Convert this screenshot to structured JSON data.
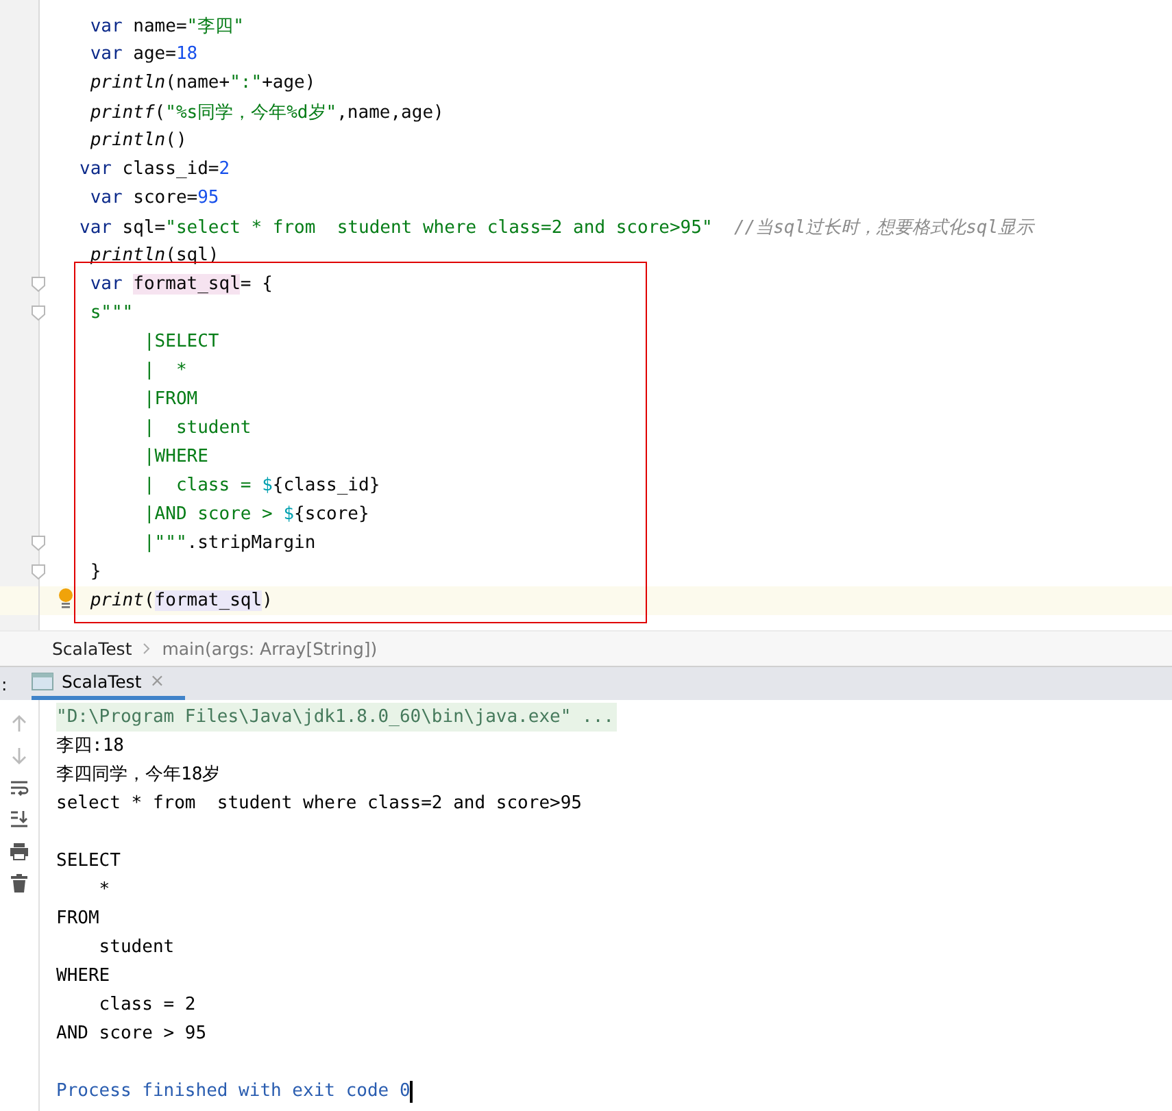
{
  "editor": {
    "lines": [
      {
        "fold": false,
        "current": false,
        "tokens": [
          {
            "kind": "keyword",
            "text": " var"
          },
          {
            "kind": "plain",
            "text": " name="
          },
          {
            "kind": "string",
            "text": "\"李四\""
          }
        ]
      },
      {
        "fold": false,
        "current": false,
        "tokens": [
          {
            "kind": "keyword",
            "text": " var"
          },
          {
            "kind": "plain",
            "text": " age="
          },
          {
            "kind": "number",
            "text": "18"
          }
        ]
      },
      {
        "fold": false,
        "current": false,
        "tokens": [
          {
            "kind": "call",
            "text": " println"
          },
          {
            "kind": "plain",
            "text": "(name+"
          },
          {
            "kind": "string",
            "text": "\":\""
          },
          {
            "kind": "plain",
            "text": "+age)"
          }
        ]
      },
      {
        "fold": false,
        "current": false,
        "tokens": [
          {
            "kind": "call",
            "text": " printf"
          },
          {
            "kind": "plain",
            "text": "("
          },
          {
            "kind": "string",
            "text": "\"%s同学，今年%d岁\""
          },
          {
            "kind": "plain",
            "text": ",name,age)"
          }
        ]
      },
      {
        "fold": false,
        "current": false,
        "tokens": [
          {
            "kind": "call",
            "text": " println"
          },
          {
            "kind": "plain",
            "text": "()"
          }
        ]
      },
      {
        "fold": false,
        "current": false,
        "tokens": [
          {
            "kind": "keyword",
            "text": "var"
          },
          {
            "kind": "plain",
            "text": " class_id="
          },
          {
            "kind": "number",
            "text": "2"
          }
        ]
      },
      {
        "fold": false,
        "current": false,
        "tokens": [
          {
            "kind": "keyword",
            "text": " var"
          },
          {
            "kind": "plain",
            "text": " score="
          },
          {
            "kind": "number",
            "text": "95"
          }
        ]
      },
      {
        "fold": false,
        "current": false,
        "tokens": [
          {
            "kind": "keyword",
            "text": "var"
          },
          {
            "kind": "plain",
            "text": " sql="
          },
          {
            "kind": "string",
            "text": "\"select * from  student where class=2 and score>95\""
          },
          {
            "kind": "comment",
            "text": "  //当sql过长时，想要格式化sql显示"
          }
        ]
      },
      {
        "fold": false,
        "current": false,
        "tokens": [
          {
            "kind": "call",
            "text": " println"
          },
          {
            "kind": "plain",
            "text": "(sql)"
          }
        ]
      },
      {
        "fold": true,
        "current": false,
        "tokens": [
          {
            "kind": "keyword",
            "text": " var "
          },
          {
            "kind": "definition",
            "text": "format_sql"
          },
          {
            "kind": "plain",
            "text": "= {"
          }
        ]
      },
      {
        "fold": true,
        "current": false,
        "tokens": [
          {
            "kind": "string",
            "text": " s\"\"\""
          }
        ]
      },
      {
        "fold": false,
        "current": false,
        "tokens": [
          {
            "kind": "string",
            "text": "      |SELECT"
          }
        ]
      },
      {
        "fold": false,
        "current": false,
        "tokens": [
          {
            "kind": "string",
            "text": "      |  *"
          }
        ]
      },
      {
        "fold": false,
        "current": false,
        "tokens": [
          {
            "kind": "string",
            "text": "      |FROM"
          }
        ]
      },
      {
        "fold": false,
        "current": false,
        "tokens": [
          {
            "kind": "string",
            "text": "      |  student"
          }
        ]
      },
      {
        "fold": false,
        "current": false,
        "tokens": [
          {
            "kind": "string",
            "text": "      |WHERE"
          }
        ]
      },
      {
        "fold": false,
        "current": false,
        "tokens": [
          {
            "kind": "string",
            "text": "      |  class = "
          },
          {
            "kind": "dollar",
            "text": "$"
          },
          {
            "kind": "plain",
            "text": "{class_id}"
          }
        ]
      },
      {
        "fold": false,
        "current": false,
        "tokens": [
          {
            "kind": "string",
            "text": "      |AND score > "
          },
          {
            "kind": "dollar",
            "text": "$"
          },
          {
            "kind": "plain",
            "text": "{score}"
          }
        ]
      },
      {
        "fold": true,
        "current": false,
        "tokens": [
          {
            "kind": "string",
            "text": "      |\"\"\""
          },
          {
            "kind": "plain",
            "text": ".stripMargin"
          }
        ]
      },
      {
        "fold": true,
        "current": false,
        "tokens": [
          {
            "kind": "plain",
            "text": " }"
          }
        ]
      },
      {
        "fold": false,
        "current": true,
        "tokens": [
          {
            "kind": "call",
            "text": " print"
          },
          {
            "kind": "plain",
            "text": "("
          },
          {
            "kind": "reference",
            "text": "format_sql"
          },
          {
            "kind": "plain",
            "text": ")"
          }
        ]
      }
    ]
  },
  "breadcrumbs": [
    {
      "text": "ScalaTest"
    },
    {
      "text": "main(args: Array[String])"
    }
  ],
  "run_panel": {
    "edge_label": ":",
    "tabs": [
      {
        "label": "ScalaTest",
        "selected": true,
        "close": "×"
      }
    ]
  },
  "console": {
    "lines": [
      {
        "kind": "command",
        "text": "\"D:\\Program Files\\Java\\jdk1.8.0_60\\bin\\java.exe\" ..."
      },
      {
        "kind": "output",
        "text": "李四:18"
      },
      {
        "kind": "output",
        "text": "李四同学，今年18岁"
      },
      {
        "kind": "output",
        "text": "select * from  student where class=2 and score>95"
      },
      {
        "kind": "gap"
      },
      {
        "kind": "output",
        "text": "SELECT"
      },
      {
        "kind": "output",
        "text": "    *"
      },
      {
        "kind": "output",
        "text": "FROM"
      },
      {
        "kind": "output",
        "text": "    student"
      },
      {
        "kind": "output",
        "text": "WHERE"
      },
      {
        "kind": "output",
        "text": "    class = 2"
      },
      {
        "kind": "output",
        "text": "AND score > 95"
      },
      {
        "kind": "gap"
      },
      {
        "kind": "exit",
        "text": "Process finished with exit code 0"
      }
    ]
  }
}
